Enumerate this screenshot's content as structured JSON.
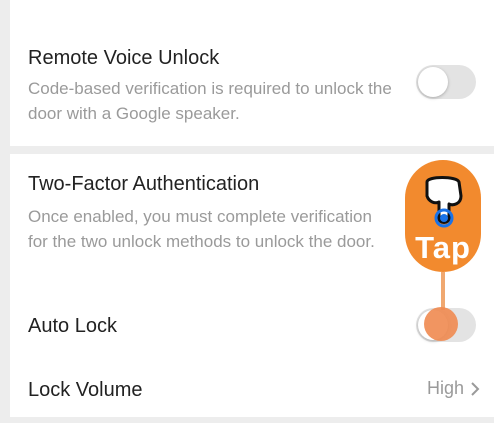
{
  "partial_top_toggle": {
    "state": "on"
  },
  "remote_voice_unlock": {
    "title": "Remote Voice Unlock",
    "description": "Code-based verification is required to unlock the door with a Google speaker.",
    "state": "off"
  },
  "two_factor": {
    "title": "Two-Factor Authentication",
    "description": "Once enabled, you must complete verification for the two unlock methods to unlock the door."
  },
  "auto_lock": {
    "title": "Auto Lock",
    "state": "off"
  },
  "lock_volume": {
    "title": "Lock Volume",
    "value": "High"
  },
  "tap_hint": {
    "label": "Tap",
    "icon": "pointing-hand-icon",
    "color": "#f28a2e"
  },
  "colors": {
    "toggle_on": "#2f8f6a",
    "toggle_off": "#e3e3e3",
    "background": "#ededed"
  }
}
